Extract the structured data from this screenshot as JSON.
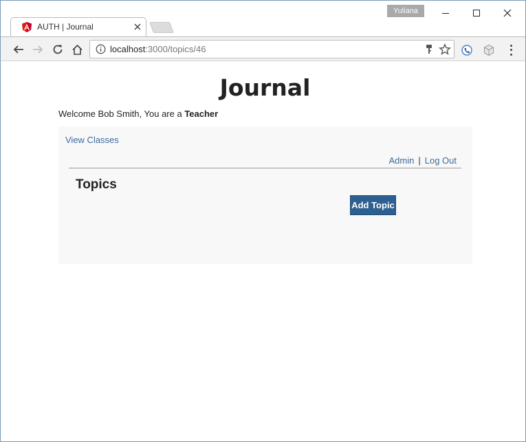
{
  "window": {
    "profile_name": "Yuliana",
    "controls": {
      "minimize": "minimize",
      "maximize": "maximize",
      "close": "close"
    }
  },
  "tab": {
    "title": "AUTH | Journal",
    "favicon": "angular-icon",
    "close_icon": "close-icon"
  },
  "toolbar": {
    "url_host": "localhost",
    "url_path": ":3000/topics/46",
    "icons": [
      "back-icon",
      "forward-icon",
      "reload-icon",
      "home-icon",
      "info-icon",
      "key-icon",
      "star-icon",
      "extension-icon",
      "extension-cube-icon",
      "menu-icon"
    ]
  },
  "page": {
    "title": "Journal",
    "welcome_prefix": "Welcome Bob Smith, You are a ",
    "role": "Teacher",
    "nav": {
      "view_classes": "View Classes",
      "admin": "Admin",
      "separator": "|",
      "logout": "Log Out"
    },
    "topics_heading": "Topics",
    "add_topic_label": "Add Topic"
  },
  "colors": {
    "link": "#3d6a9a",
    "button": "#2d6091",
    "panel_bg": "#f8f8f8",
    "profile_badge": "#a9a9a9",
    "favicon_red": "#dd1b16"
  }
}
